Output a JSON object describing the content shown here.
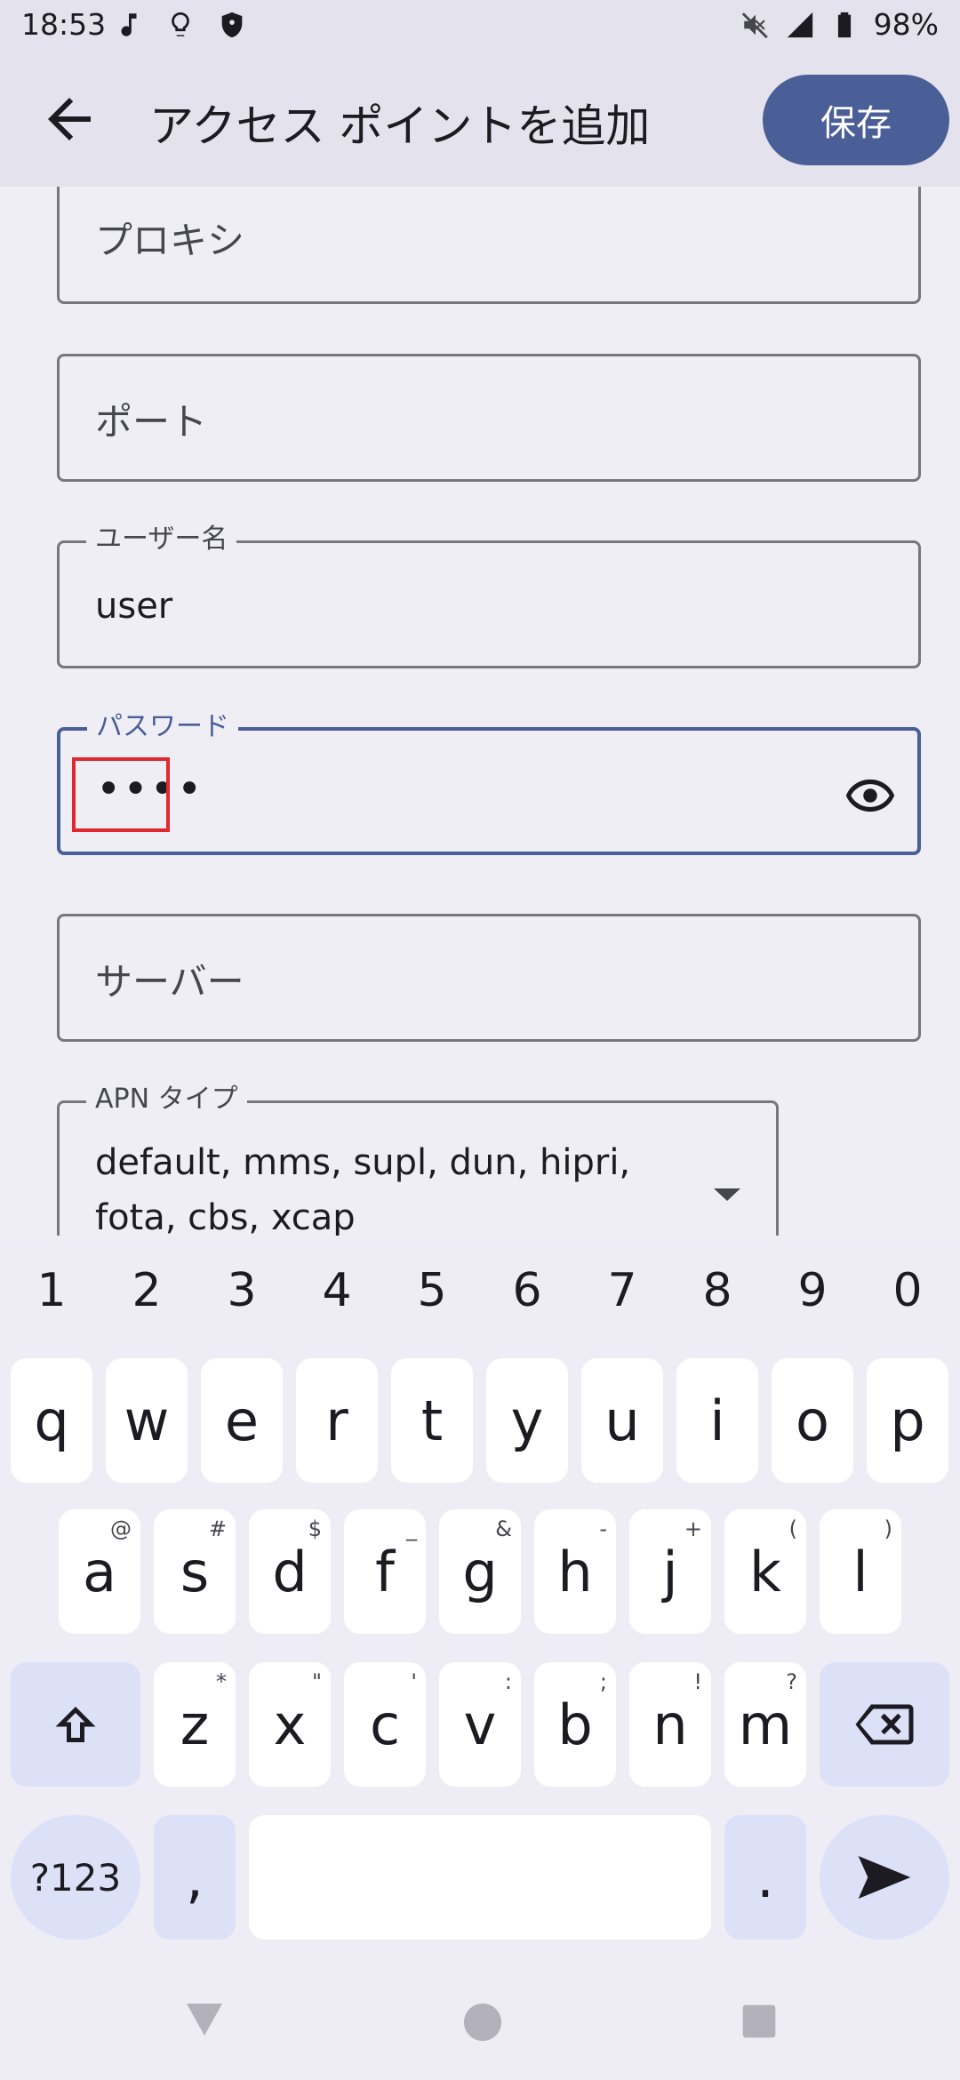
{
  "status_bar": {
    "time": "18:53",
    "left_icons": [
      "music-note-icon",
      "lightbulb-icon",
      "shield-icon"
    ],
    "right_icons": [
      "mute-icon",
      "signal-icon",
      "battery-icon"
    ],
    "battery": "98%"
  },
  "app_bar": {
    "title": "アクセス ポイントを追加",
    "save_label": "保存"
  },
  "form": {
    "proxy": {
      "placeholder": "プロキシ"
    },
    "port": {
      "placeholder": "ポート"
    },
    "username": {
      "label": "ユーザー名",
      "value": "user"
    },
    "password": {
      "label": "パスワード",
      "value": "••••"
    },
    "server": {
      "placeholder": "サーバー"
    },
    "apn_type": {
      "label": "APN タイプ",
      "line1": "default, mms, supl, dun, hipri,",
      "line2": "fota, cbs, xcap"
    }
  },
  "keyboard": {
    "numbers": [
      "1",
      "2",
      "3",
      "4",
      "5",
      "6",
      "7",
      "8",
      "9",
      "0"
    ],
    "row1": [
      "q",
      "w",
      "e",
      "r",
      "t",
      "y",
      "u",
      "i",
      "o",
      "p"
    ],
    "row2": [
      {
        "k": "a",
        "s": "@"
      },
      {
        "k": "s",
        "s": "#"
      },
      {
        "k": "d",
        "s": "$"
      },
      {
        "k": "f",
        "s": "_"
      },
      {
        "k": "g",
        "s": "&"
      },
      {
        "k": "h",
        "s": "-"
      },
      {
        "k": "j",
        "s": "+"
      },
      {
        "k": "k",
        "s": "("
      },
      {
        "k": "l",
        "s": ")"
      }
    ],
    "row3": [
      {
        "k": "z",
        "s": "*"
      },
      {
        "k": "x",
        "s": "\""
      },
      {
        "k": "c",
        "s": "'"
      },
      {
        "k": "v",
        "s": ":"
      },
      {
        "k": "b",
        "s": ";"
      },
      {
        "k": "n",
        "s": "!"
      },
      {
        "k": "m",
        "s": "?"
      }
    ],
    "symbols_label": "?123",
    "comma": ",",
    "period": "."
  }
}
